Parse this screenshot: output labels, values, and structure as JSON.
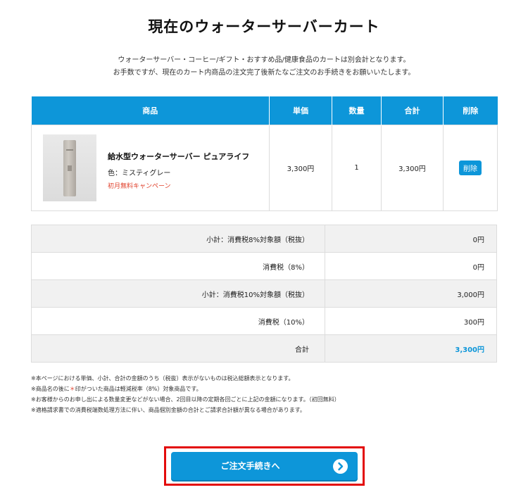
{
  "page": {
    "title": "現在のウォーターサーバーカート",
    "intro_line1": "ウォーターサーバー・コーヒー/ギフト・おすすめ品/健康食品のカートは別会計となります。",
    "intro_line2": "お手数ですが、現在のカート内商品の注文完了後新たなご注文のお手続きをお願いいたします。"
  },
  "cart": {
    "headers": {
      "item": "商品",
      "unit_price": "単価",
      "quantity": "数量",
      "total": "合計",
      "delete": "削除"
    },
    "items": [
      {
        "name": "給水型ウォーターサーバー ピュアライフ",
        "color": "色：ミスティグレー",
        "campaign": "初月無料キャンペーン",
        "unit_price": "3,300円",
        "quantity": "1",
        "total": "3,300円",
        "delete_label": "削除"
      }
    ]
  },
  "summary": [
    {
      "label": "小計：消費税8%対象額（税抜）",
      "value": "0円"
    },
    {
      "label": "消費税（8%）",
      "value": "0円"
    },
    {
      "label": "小計：消費税10%対象額（税抜）",
      "value": "3,000円"
    },
    {
      "label": "消費税（10%）",
      "value": "300円"
    },
    {
      "label": "合計",
      "value": "3,300円"
    }
  ],
  "notes": {
    "n1": "※本ページにおける単価、小計、合計の金額のうち（税抜）表示がないものは税込総額表示となります。",
    "n2_pre": "※商品名の後に",
    "n2_star": "＊",
    "n2_post": "印がついた商品は軽減税率（8%）対象商品です。",
    "n3": "※お客様からのお申し出による数量変更などがない場合、2回目以降の定期各回ごとに上記の金額になります。（初回無料）",
    "n4": "※適格請求書での消費税端数処理方法に伴い、商品個別金額の合計とご請求合計額が異なる場合があります。"
  },
  "checkout": {
    "label": "ご注文手続きへ",
    "icon": "chevron-right-circle-icon"
  },
  "colors": {
    "accent": "#0d96d9",
    "campaign": "#e0402b",
    "highlight": "#e30b0b"
  }
}
